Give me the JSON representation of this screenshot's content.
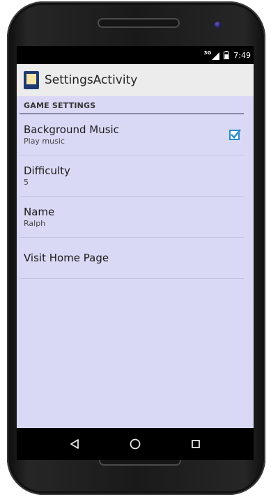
{
  "status_bar": {
    "network": "3G",
    "time": "7:49"
  },
  "app_bar": {
    "title": "SettingsActivity"
  },
  "category": {
    "label": "GAME SETTINGS"
  },
  "preferences": [
    {
      "title": "Background Music",
      "summary": "Play music",
      "checked": true
    },
    {
      "title": "Difficulty",
      "summary": "5"
    },
    {
      "title": "Name",
      "summary": "Ralph"
    },
    {
      "title": "Visit Home Page",
      "summary": ""
    }
  ],
  "navigation": {
    "back_icon": "back-triangle-icon",
    "home_icon": "home-circle-icon",
    "recents_icon": "recents-square-icon"
  },
  "colors": {
    "screen_background": "#d9d9f6",
    "checkbox_accent": "#2a8bc8",
    "app_bar": "#ececec"
  }
}
